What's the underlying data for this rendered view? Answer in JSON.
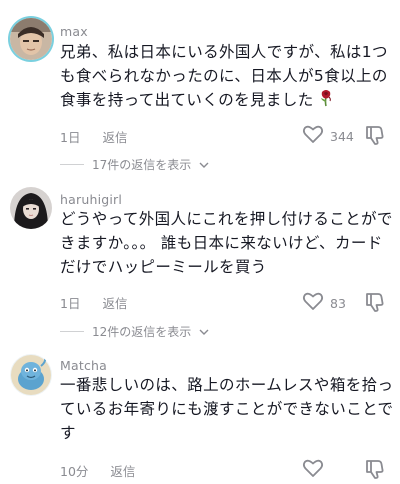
{
  "comments": [
    {
      "username": "max",
      "text_lines": [
        "兄弟、私は日本にいる外国人ですが、私は1つ",
        "も食べられなかったのに、日本人が5食以上の",
        "食事を持って出ていくのを見ました"
      ],
      "emoji_icon": "wilted-rose-icon",
      "time": "1日",
      "reply_label": "返信",
      "like_count": "344",
      "view_replies": "17件の返信を表示"
    },
    {
      "username": "haruhigirl",
      "text_lines": [
        "どうやって外国人にこれを押し付けることがで",
        "きますか。。。 誰も日本に来ないけど、カード",
        "だけでハッピーミールを買う"
      ],
      "time": "1日",
      "reply_label": "返信",
      "like_count": "83",
      "view_replies": "12件の返信を表示"
    },
    {
      "username": "Matcha",
      "text_lines": [
        "一番悲しいのは、路上のホームレスや箱を拾っ",
        "ているお年寄りにも渡すことができないことで",
        "す"
      ],
      "time": "10分",
      "reply_label": "返信",
      "like_count": ""
    }
  ],
  "colors": {
    "text": "#161823",
    "secondary": "#8a8b91",
    "divider": "#d0d1d3"
  }
}
